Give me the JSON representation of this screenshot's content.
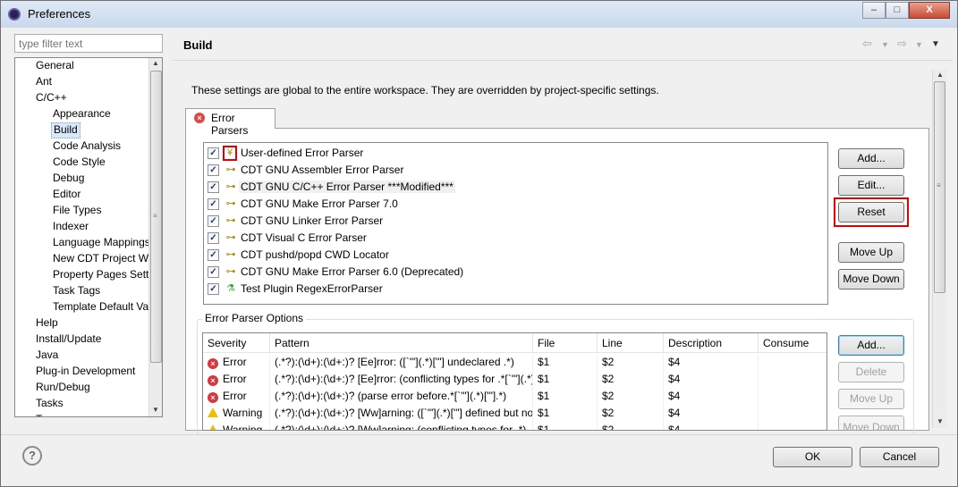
{
  "window": {
    "title": "Preferences",
    "minimize": "–",
    "maximize": "□",
    "close": "X"
  },
  "filter": {
    "placeholder": "type filter text"
  },
  "tree": {
    "items": [
      {
        "label": "General",
        "level": 0
      },
      {
        "label": "Ant",
        "level": 0
      },
      {
        "label": "C/C++",
        "level": 0
      },
      {
        "label": "Appearance",
        "level": 1
      },
      {
        "label": "Build",
        "level": 1,
        "selected": true
      },
      {
        "label": "Code Analysis",
        "level": 1
      },
      {
        "label": "Code Style",
        "level": 1
      },
      {
        "label": "Debug",
        "level": 1
      },
      {
        "label": "Editor",
        "level": 1
      },
      {
        "label": "File Types",
        "level": 1
      },
      {
        "label": "Indexer",
        "level": 1
      },
      {
        "label": "Language Mappings",
        "level": 1
      },
      {
        "label": "New CDT Project Wi",
        "level": 1
      },
      {
        "label": "Property Pages Setti",
        "level": 1
      },
      {
        "label": "Task Tags",
        "level": 1
      },
      {
        "label": "Template Default Va",
        "level": 1
      },
      {
        "label": "Help",
        "level": 0
      },
      {
        "label": "Install/Update",
        "level": 0
      },
      {
        "label": "Java",
        "level": 0
      },
      {
        "label": "Plug-in Development",
        "level": 0
      },
      {
        "label": "Run/Debug",
        "level": 0
      },
      {
        "label": "Tasks",
        "level": 0
      },
      {
        "label": "Team",
        "level": 0
      }
    ]
  },
  "page": {
    "title": "Build",
    "description": "These settings are global to the entire workspace.  They are overridden by project-specific settings."
  },
  "tab": {
    "label": "Error Parsers"
  },
  "parsers": [
    {
      "label": "User-defined Error Parser",
      "icon": "user-defined-parser-icon",
      "checked": true
    },
    {
      "label": "CDT GNU Assembler Error Parser",
      "icon": "parser-plug-icon",
      "checked": true
    },
    {
      "label": "CDT GNU C/C++ Error Parser ***Modified***",
      "icon": "parser-plug-modified-icon",
      "checked": true
    },
    {
      "label": "CDT GNU Make Error Parser 7.0",
      "icon": "parser-plug-icon",
      "checked": true
    },
    {
      "label": "CDT GNU Linker Error Parser",
      "icon": "parser-plug-icon",
      "checked": true
    },
    {
      "label": "CDT Visual C Error Parser",
      "icon": "parser-plug-icon",
      "checked": true
    },
    {
      "label": "CDT pushd/popd CWD Locator",
      "icon": "parser-plug-icon",
      "checked": true
    },
    {
      "label": "CDT GNU Make Error Parser 6.0 (Deprecated)",
      "icon": "parser-plug-deprecated-icon",
      "checked": true
    },
    {
      "label": "Test Plugin RegexErrorParser",
      "icon": "flask-icon",
      "checked": true
    }
  ],
  "parser_buttons": {
    "add": "Add...",
    "edit": "Edit...",
    "reset": "Reset",
    "move_up": "Move Up",
    "move_down": "Move Down"
  },
  "options": {
    "title": "Error Parser Options",
    "columns": [
      "Severity",
      "Pattern",
      "File",
      "Line",
      "Description",
      "Consume"
    ],
    "rows": [
      {
        "severity": "Error",
        "pattern": "(.*?):(\\d+):(\\d+:)? [Ee]rror: ([`'\"](.*)['\"] undeclared .*)",
        "file": "$1",
        "line": "$2",
        "description": "$4",
        "consume": ""
      },
      {
        "severity": "Error",
        "pattern": "(.*?):(\\d+):(\\d+:)? [Ee]rror: (conflicting types for .*[`'\"](.*)['\"].*)",
        "file": "$1",
        "line": "$2",
        "description": "$4",
        "consume": ""
      },
      {
        "severity": "Error",
        "pattern": "(.*?):(\\d+):(\\d+:)? (parse error before.*[`'\"](.*)['\"].*)",
        "file": "$1",
        "line": "$2",
        "description": "$4",
        "consume": ""
      },
      {
        "severity": "Warning",
        "pattern": "(.*?):(\\d+):(\\d+:)? [Ww]arning: ([`'\"](.*)['\"] defined but not used.*)",
        "file": "$1",
        "line": "$2",
        "description": "$4",
        "consume": ""
      },
      {
        "severity": "Warning",
        "pattern": "(.*?):(\\d+):(\\d+:)? [Ww]arning: (conflicting types for .*)",
        "file": "$1",
        "line": "$2",
        "description": "$4",
        "consume": ""
      }
    ],
    "buttons": {
      "add": "Add...",
      "delete": "Delete",
      "move_up": "Move Up",
      "move_down": "Move Down"
    }
  },
  "footer": {
    "ok": "OK",
    "cancel": "Cancel",
    "help": "?"
  }
}
